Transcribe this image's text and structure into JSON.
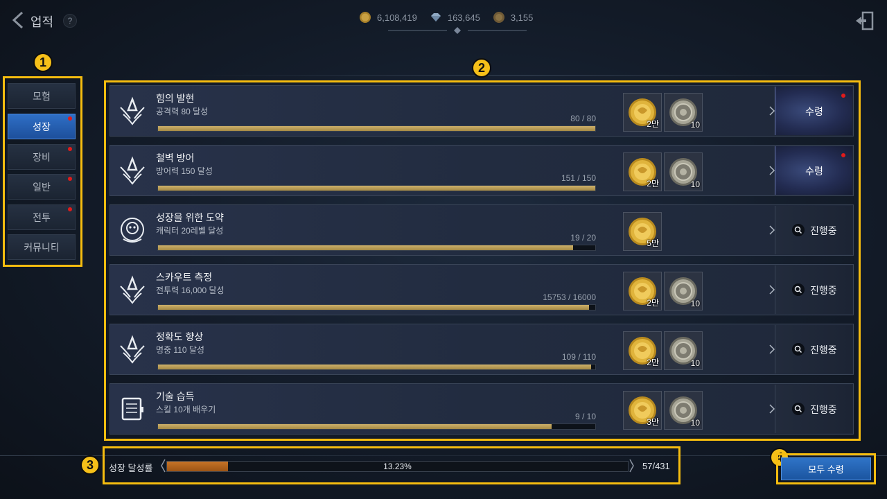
{
  "header": {
    "title": "업적",
    "help_label": "?",
    "currencies": [
      {
        "icon": "gold-coin-icon",
        "value": "6,108,419"
      },
      {
        "icon": "diamond-icon",
        "value": "163,645"
      },
      {
        "icon": "bronze-coin-icon",
        "value": "3,155"
      }
    ]
  },
  "sidebar": {
    "items": [
      {
        "label": "모험",
        "active": false,
        "notify": false
      },
      {
        "label": "성장",
        "active": true,
        "notify": true
      },
      {
        "label": "장비",
        "active": false,
        "notify": true
      },
      {
        "label": "일반",
        "active": false,
        "notify": true
      },
      {
        "label": "전투",
        "active": false,
        "notify": true
      },
      {
        "label": "커뮤니티",
        "active": false,
        "notify": false
      }
    ]
  },
  "callouts": [
    "1",
    "2",
    "3",
    "4"
  ],
  "achievements": [
    {
      "name": "힘의 발현",
      "desc": "공격력 80 달성",
      "progress": "80 / 80",
      "ratio": 1.0,
      "rewards": [
        "2만",
        "10"
      ],
      "status": "수령",
      "claimable": true
    },
    {
      "name": "철벽 방어",
      "desc": "방어력 150 달성",
      "progress": "151 / 150",
      "ratio": 1.0,
      "rewards": [
        "2만",
        "10"
      ],
      "status": "수령",
      "claimable": true
    },
    {
      "name": "성장을 위한 도약",
      "desc": "캐릭터 20레벨 달성",
      "progress": "19 / 20",
      "ratio": 0.95,
      "rewards": [
        "5만"
      ],
      "status": "진행중",
      "claimable": false
    },
    {
      "name": "스카우트 측정",
      "desc": "전투력 16,000 달성",
      "progress": "15753 / 16000",
      "ratio": 0.985,
      "rewards": [
        "2만",
        "10"
      ],
      "status": "진행중",
      "claimable": false
    },
    {
      "name": "정확도 향상",
      "desc": "명중 110 달성",
      "progress": "109 / 110",
      "ratio": 0.991,
      "rewards": [
        "2만",
        "10"
      ],
      "status": "진행중",
      "claimable": false
    },
    {
      "name": "기술 습득",
      "desc": "스킬 10개 배우기",
      "progress": "9 / 10",
      "ratio": 0.9,
      "rewards": [
        "3만",
        "10"
      ],
      "status": "진행중",
      "claimable": false
    }
  ],
  "total": {
    "label": "성장 달성률",
    "percent_text": "13.23%",
    "ratio": 0.1323,
    "count": "57/431"
  },
  "claim_all": {
    "label": "모두 수령"
  },
  "colors": {
    "highlight": "#f6bd0f",
    "active_tab": "#2f6fc6",
    "notify_dot": "#e01b1b",
    "progress_gold": "#c3a55d",
    "total_fill": "#c77326"
  }
}
